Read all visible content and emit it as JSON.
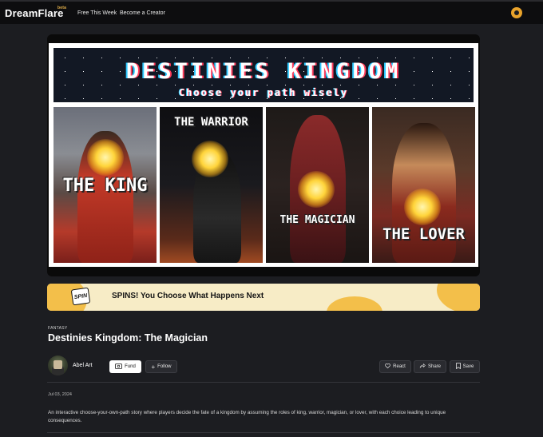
{
  "header": {
    "logo_text": "DreamFlare",
    "logo_badge": "beta",
    "nav": [
      "Free This Week",
      "Become a Creator"
    ]
  },
  "hero": {
    "title": "DESTINIES KINGDOM",
    "subtitle": "Choose your path wisely",
    "cards": [
      "THE KING",
      "THE WARRIOR",
      "THE MAGICIAN",
      "THE LOVER"
    ]
  },
  "banner": {
    "badge": "SPIN",
    "text": "SPINS! You Choose What Happens Next"
  },
  "story": {
    "category": "FANTASY",
    "title": "Destinies Kingdom: The Magician",
    "author": "Abel Art",
    "date": "Jul 03, 2024",
    "description": "An interactive choose-your-own-path story where players decide the fate of a kingdom by assuming the roles of king, warrior, magician, or lover, with each choice leading to unique consequences."
  },
  "actions": {
    "fund": "Fund",
    "follow": "Follow",
    "react": "React",
    "share": "Share",
    "save": "Save"
  },
  "colors": {
    "background": "#1c1d21",
    "topbar": "#0d0d0f",
    "banner_bg": "#f7ecc6",
    "banner_accent": "#f3bf4a",
    "orb": "#ffd43a"
  },
  "icons": [
    "logo-swirl-icon",
    "user-avatar-icon",
    "fund-icon",
    "plus-icon",
    "heart-icon",
    "share-icon",
    "bookmark-icon"
  ]
}
